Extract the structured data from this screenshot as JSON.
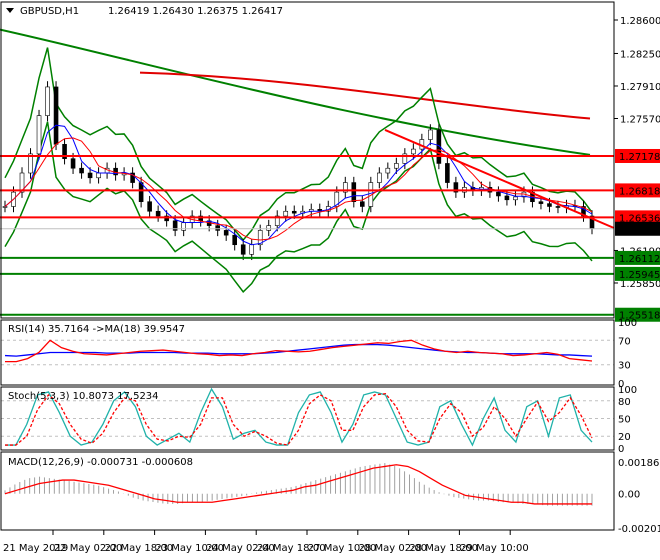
{
  "header": {
    "symbol": "GBPUSD,H1",
    "ohlc": "1.26419 1.26430 1.26375 1.26417"
  },
  "colors": {
    "up_red": "#ff0000",
    "green": "#008000",
    "blue": "#0000ff",
    "teal": "#20b2aa",
    "bg": "#ffffff",
    "current": "#000000"
  },
  "chart_data": [
    {
      "type": "candlestick",
      "name": "main",
      "price_ticks": [
        1.286,
        1.2825,
        1.2791,
        1.2757,
        1.2619,
        1.2585
      ],
      "ylim": [
        1.2545,
        1.2885
      ],
      "current_price": "1.26417",
      "levels": [
        {
          "label": "1.27178",
          "value": 1.27178,
          "color": "#ff0000"
        },
        {
          "label": "1.26818",
          "value": 1.26818,
          "color": "#ff0000"
        },
        {
          "label": "1.26536",
          "value": 1.26536,
          "color": "#ff0000"
        },
        {
          "label": "1.26112",
          "value": 1.26112,
          "color": "#008000"
        },
        {
          "label": "1.25945",
          "value": 1.25945,
          "color": "#008000"
        },
        {
          "label": "1.25518",
          "value": 1.25518,
          "color": "#008000"
        }
      ],
      "close": [
        1.2665,
        1.268,
        1.27,
        1.272,
        1.276,
        1.279,
        1.273,
        1.2715,
        1.2705,
        1.27,
        1.2695,
        1.27,
        1.2705,
        1.2698,
        1.27,
        1.269,
        1.267,
        1.266,
        1.2655,
        1.265,
        1.264,
        1.2648,
        1.2655,
        1.265,
        1.2645,
        1.264,
        1.2635,
        1.2625,
        1.2615,
        1.2625,
        1.264,
        1.2645,
        1.2655,
        1.266,
        1.2658,
        1.266,
        1.2662,
        1.266,
        1.2665,
        1.268,
        1.269,
        1.267,
        1.2665,
        1.269,
        1.27,
        1.2705,
        1.271,
        1.272,
        1.2725,
        1.2735,
        1.2745,
        1.271,
        1.269,
        1.268,
        1.2685,
        1.2682,
        1.2685,
        1.268,
        1.2676,
        1.2672,
        1.2675,
        1.268,
        1.267,
        1.2668,
        1.2665,
        1.2664,
        1.2666,
        1.2665,
        1.2655,
        1.2642
      ]
    },
    {
      "type": "line",
      "name": "RSI",
      "title": "RSI(14) 35.7164  ->MA(18) 39.9547",
      "ylim": [
        0,
        100
      ],
      "ticks": [
        "100",
        "70",
        "30",
        "0"
      ],
      "rsi": [
        35,
        35,
        40,
        50,
        70,
        58,
        52,
        48,
        47,
        46,
        48,
        50,
        52,
        53,
        54,
        52,
        50,
        48,
        47,
        45,
        46,
        45,
        48,
        50,
        53,
        52,
        51,
        52,
        55,
        58,
        60,
        62,
        64,
        66,
        65,
        68,
        70,
        62,
        56,
        52,
        50,
        52,
        50,
        49,
        48,
        45,
        46,
        48,
        50,
        47,
        40,
        38,
        36
      ],
      "ma": [
        45,
        44,
        46,
        48,
        50,
        50,
        50,
        50,
        50,
        49,
        49,
        49,
        50,
        50,
        50,
        50,
        49,
        49,
        49,
        48,
        48,
        48,
        48,
        49,
        50,
        52,
        54,
        56,
        58,
        60,
        62,
        63,
        63,
        63,
        62,
        60,
        58,
        56,
        54,
        52,
        51,
        50,
        50,
        49,
        48,
        48,
        48,
        48,
        47,
        46,
        46,
        45,
        44
      ]
    },
    {
      "type": "line",
      "name": "Stochastic",
      "title": "Stoch(5,3,3) 10.8073 17.5234",
      "ylim": [
        0,
        100
      ],
      "ticks": [
        "100",
        "80",
        "50",
        "20",
        "0"
      ],
      "k": [
        5,
        5,
        40,
        90,
        95,
        60,
        20,
        5,
        10,
        40,
        80,
        95,
        70,
        20,
        5,
        15,
        25,
        10,
        60,
        100,
        70,
        15,
        25,
        30,
        10,
        5,
        5,
        60,
        90,
        95,
        60,
        10,
        40,
        90,
        95,
        90,
        50,
        10,
        5,
        10,
        70,
        80,
        40,
        5,
        50,
        85,
        30,
        10,
        70,
        80,
        20,
        85,
        90,
        30,
        10
      ],
      "d": [
        5,
        5,
        20,
        65,
        90,
        75,
        40,
        15,
        8,
        25,
        60,
        85,
        80,
        40,
        15,
        12,
        20,
        18,
        40,
        85,
        85,
        40,
        20,
        28,
        20,
        8,
        5,
        30,
        75,
        90,
        80,
        30,
        30,
        70,
        90,
        92,
        70,
        30,
        12,
        10,
        50,
        75,
        60,
        20,
        35,
        70,
        50,
        20,
        50,
        78,
        45,
        60,
        85,
        55,
        17
      ]
    },
    {
      "type": "histogram",
      "name": "MACD",
      "title": "MACD(12,26,9) -0.000731 -0.000608",
      "ylim": [
        -0.002011,
        0.001861
      ],
      "ticks": [
        "0.001861",
        "0.00",
        "-0.002011"
      ],
      "hist": [
        0.0002,
        0.0006,
        0.0009,
        0.001,
        0.0009,
        0.0008,
        0.0007,
        0.0006,
        0.0005,
        0.0003,
        0.0001,
        -0.0002,
        -0.0004,
        -0.0005,
        -0.0006,
        -0.0006,
        -0.0005,
        -0.0005,
        -0.0004,
        -0.0003,
        -0.0002,
        -0.0001,
        0.0001,
        0.0002,
        0.0003,
        0.0004,
        0.0006,
        0.0008,
        0.001,
        0.0012,
        0.0014,
        0.0016,
        0.0017,
        0.0018,
        0.0016,
        0.0012,
        0.0007,
        0.0003,
        0.0,
        -0.0002,
        -0.0003,
        -0.0004,
        -0.0004,
        -0.0005,
        -0.0005,
        -0.0006,
        -0.0006,
        -0.0007,
        -0.0007,
        -0.0007,
        -0.0007,
        -0.0007
      ],
      "signal": [
        0.0,
        0.0002,
        0.0004,
        0.0006,
        0.0007,
        0.0008,
        0.0008,
        0.0007,
        0.0006,
        0.0005,
        0.0003,
        0.0001,
        -0.0001,
        -0.0003,
        -0.0004,
        -0.0005,
        -0.0005,
        -0.0005,
        -0.0005,
        -0.0004,
        -0.0003,
        -0.0002,
        -0.0001,
        0.0,
        0.0001,
        0.0002,
        0.0004,
        0.0005,
        0.0007,
        0.0009,
        0.0011,
        0.0013,
        0.0015,
        0.0016,
        0.0017,
        0.0016,
        0.0013,
        0.0009,
        0.0005,
        0.0002,
        -0.0001,
        -0.0002,
        -0.0003,
        -0.0004,
        -0.0005,
        -0.0005,
        -0.0006,
        -0.0006,
        -0.0006,
        -0.0006,
        -0.0006,
        -0.0006
      ]
    }
  ],
  "time_axis": [
    "21 May 2019",
    "22 May 02:00",
    "22 May 18:00",
    "23 May 10:00",
    "24 May 02:00",
    "24 May 18:00",
    "27 May 10:00",
    "28 May 02:00",
    "28 May 18:00",
    "29 May 10:00"
  ]
}
